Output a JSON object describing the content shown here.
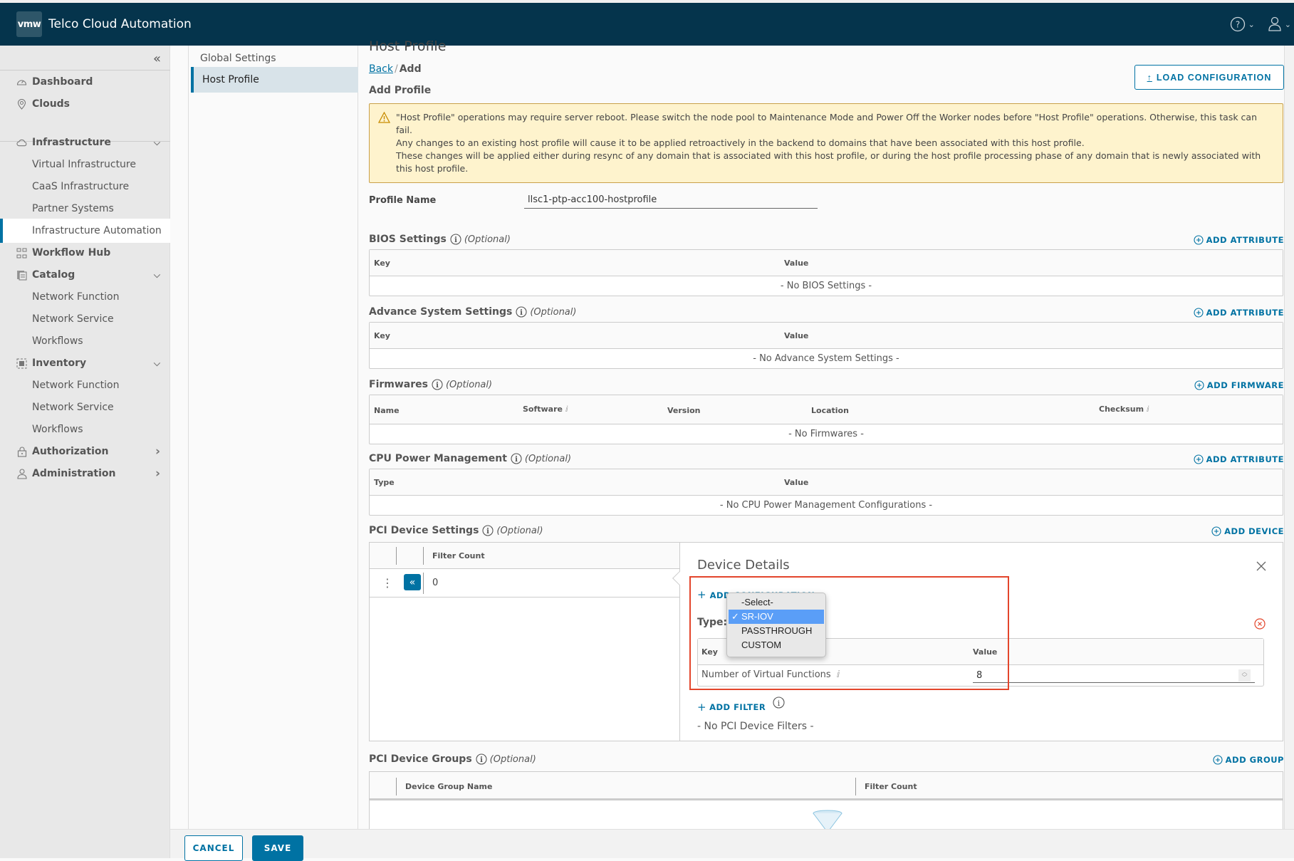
{
  "header": {
    "logo": "vmw",
    "title": "Telco Cloud Automation",
    "help_icon": "help-icon",
    "user_icon": "user-icon"
  },
  "sidebar": {
    "collapse_icon": "double-chevron-left-icon",
    "items": [
      {
        "label": "Dashboard",
        "icon": "dashboard-icon",
        "level": "top"
      },
      {
        "label": "Clouds",
        "icon": "location-icon",
        "level": "top"
      },
      {
        "label": "Infrastructure",
        "icon": "cloud-icon",
        "level": "top",
        "chevron": "down"
      },
      {
        "label": "Virtual Infrastructure",
        "level": "sub"
      },
      {
        "label": "CaaS Infrastructure",
        "level": "sub"
      },
      {
        "label": "Partner Systems",
        "level": "sub"
      },
      {
        "label": "Infrastructure Automation",
        "level": "sub",
        "active": true
      },
      {
        "label": "Workflow Hub",
        "icon": "workflow-icon",
        "level": "top"
      },
      {
        "label": "Catalog",
        "icon": "catalog-icon",
        "level": "top",
        "chevron": "down"
      },
      {
        "label": "Network Function",
        "level": "sub"
      },
      {
        "label": "Network Service",
        "level": "sub"
      },
      {
        "label": "Workflows",
        "level": "sub"
      },
      {
        "label": "Inventory",
        "icon": "inventory-icon",
        "level": "top",
        "chevron": "down"
      },
      {
        "label": "Network Function",
        "level": "sub"
      },
      {
        "label": "Network Service",
        "level": "sub"
      },
      {
        "label": "Workflows",
        "level": "sub"
      },
      {
        "label": "Authorization",
        "icon": "lock-icon",
        "level": "top",
        "chevron": "right"
      },
      {
        "label": "Administration",
        "icon": "user-icon",
        "level": "top",
        "chevron": "right"
      }
    ]
  },
  "subnav": {
    "items": [
      {
        "label": "Global Settings",
        "active": false
      },
      {
        "label": "Host Profile",
        "active": true
      }
    ]
  },
  "main": {
    "page_title": "Host Profile",
    "breadcrumb": {
      "back": "Back",
      "separator": "/",
      "current": "Add"
    },
    "subtitle": "Add Profile",
    "load_button": "LOAD CONFIGURATION",
    "warning": {
      "line1": "\"Host Profile\" operations may require server reboot. Please switch the node pool to Maintenance Mode and Power Off the Worker nodes before \"Host Profile\" operations. Otherwise, this task can fail.",
      "line2": "Any changes to an existing host profile will cause it to be applied retroactively in the backend to domains that have been associated with this host profile.",
      "line3": "These changes will be applied either during resync of any domain that is associated with this host profile, or during the host profile processing phase of any domain that is newly associated with this host profile."
    },
    "profile_name": {
      "label": "Profile Name",
      "value": "llsc1-ptp-acc100-hostprofile"
    },
    "optional": "(Optional)",
    "bios": {
      "title": "BIOS Settings",
      "action": "ADD ATTRIBUTE",
      "columns": [
        "Key",
        "Value"
      ],
      "empty": "- No BIOS Settings -"
    },
    "advanced": {
      "title": "Advance System Settings",
      "action": "ADD ATTRIBUTE",
      "columns": [
        "Key",
        "Value"
      ],
      "empty": "- No Advance System Settings -"
    },
    "firmwares": {
      "title": "Firmwares",
      "action": "ADD FIRMWARE",
      "columns": [
        "Name",
        "Software",
        "Version",
        "Location",
        "Checksum"
      ],
      "empty": "- No Firmwares -"
    },
    "cpu": {
      "title": "CPU Power Management",
      "action": "ADD ATTRIBUTE",
      "columns": [
        "Type",
        "Value"
      ],
      "empty": "- No CPU Power Management Configurations -"
    },
    "pci": {
      "title": "PCI Device Settings",
      "action": "ADD DEVICE",
      "column": "Filter Count",
      "rows": [
        {
          "filter_count": "0"
        }
      ],
      "details": {
        "title": "Device Details",
        "add_configuration": "ADD CONFIGURATION",
        "type_label": "Type:",
        "type_options": [
          "-Select-",
          "SR-IOV",
          "PASSTHROUGH",
          "CUSTOM"
        ],
        "type_selected": "SR-IOV",
        "kv_columns": [
          "Key",
          "Value"
        ],
        "kv_rows": [
          {
            "key": "Number of Virtual Functions",
            "value": "8"
          }
        ],
        "add_filter": "ADD FILTER",
        "no_filters": "- No PCI Device Filters -"
      }
    },
    "groups": {
      "title": "PCI Device Groups",
      "action": "ADD GROUP",
      "columns": [
        "Device Group Name",
        "Filter Count"
      ]
    }
  },
  "footer": {
    "cancel": "CANCEL",
    "save": "SAVE"
  },
  "colors": {
    "header": "#05344c",
    "accent": "#0072a3",
    "warning_bg": "#fef3cd",
    "highlight": "#e3452b"
  }
}
